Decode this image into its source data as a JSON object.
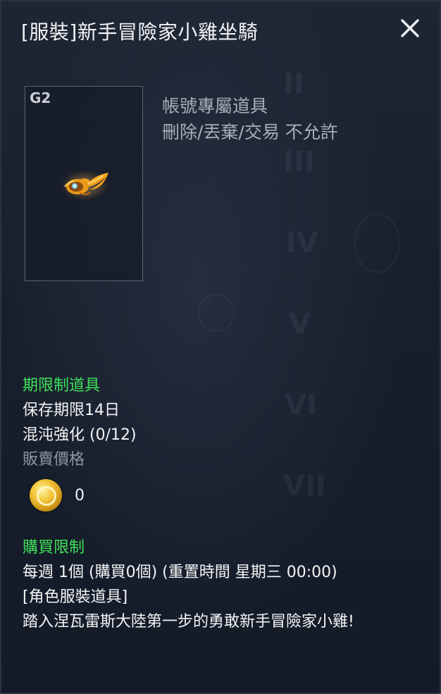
{
  "title": "[服裝]新手冒險家小雞坐騎",
  "close_icon": "close-icon",
  "item": {
    "grade": "G2",
    "icon": "chick-mount-icon"
  },
  "binding": {
    "line1": "帳號專屬道具",
    "line2": "刪除/丟棄/交易 不允許"
  },
  "period": {
    "header": "期限制道具",
    "retention": "保存期限14日",
    "chaos": "混沌強化 (0/12)"
  },
  "sell": {
    "label": "販賣價格",
    "icon": "gold-coin-icon",
    "value": "0"
  },
  "purchase": {
    "header": "購買限制",
    "limit": "每週 1個 (購買0個) (重置時間 星期三 00:00)",
    "category": "[角色服裝道具]",
    "description": "踏入涅瓦雷斯大陸第一步的勇敢新手冒險家小雞!"
  },
  "colors": {
    "green": "#3fe25a",
    "gray_label": "#8e96a6",
    "text": "#f3f4f6",
    "background": "#1c2330"
  }
}
